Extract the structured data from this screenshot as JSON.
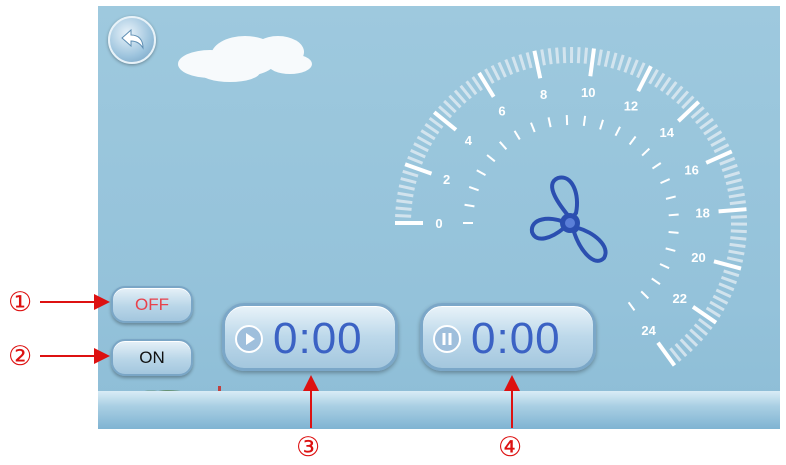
{
  "controls": {
    "off_label": "OFF",
    "on_label": "ON"
  },
  "timers": {
    "run_value": "0:00",
    "pause_value": "0:00"
  },
  "gauge": {
    "ticks": [
      "0",
      "2",
      "4",
      "6",
      "8",
      "10",
      "12",
      "14",
      "16",
      "18",
      "20",
      "22",
      "24"
    ]
  },
  "callouts": [
    "①",
    "②",
    "③",
    "④"
  ],
  "colors": {
    "screen_bg": "#9ec9de",
    "timer_text": "#3b62c4",
    "off_text": "#e8414b",
    "callout": "#dd1111",
    "fan": "#2b4fb0"
  },
  "icons": {
    "back": "back-arrow-icon",
    "fan": "fan-icon",
    "play": "play-icon",
    "pause": "pause-icon"
  }
}
